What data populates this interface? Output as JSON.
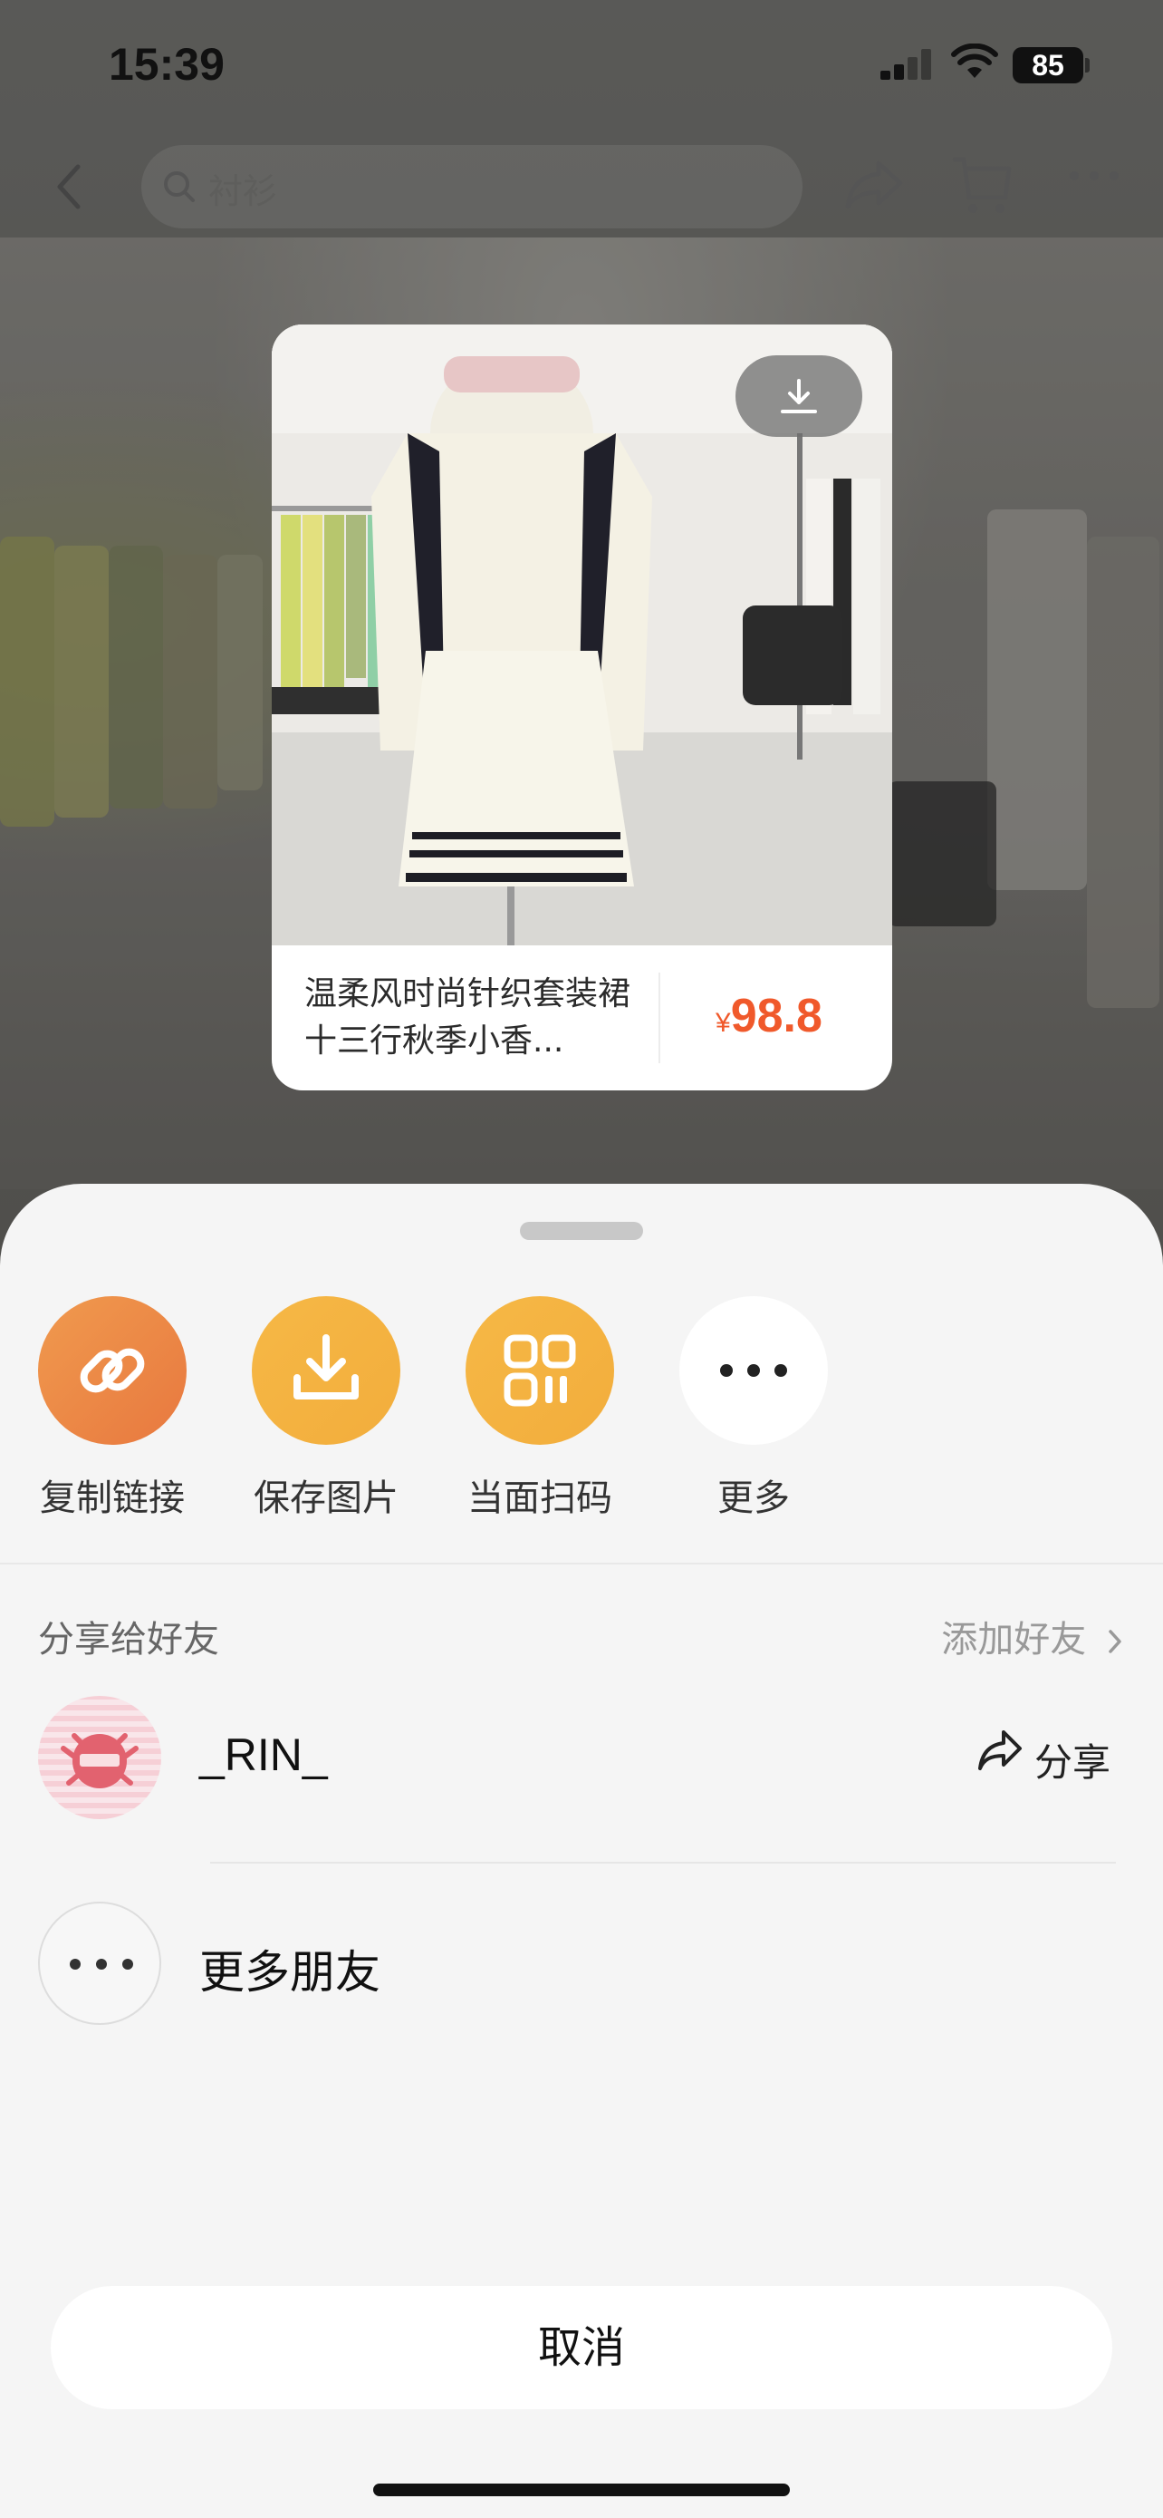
{
  "status_bar": {
    "time": "15:39",
    "battery": "85"
  },
  "nav": {
    "search_placeholder": "衬衫"
  },
  "share_card": {
    "title": "温柔风时尚针织套装裙十三行秋季小香...",
    "currency": "¥",
    "price": "98.8"
  },
  "sheet": {
    "actions": [
      {
        "label": "复制链接",
        "icon": "link-icon",
        "color": "#ec8442"
      },
      {
        "label": "保存图片",
        "icon": "download-icon",
        "color": "#f2ae3d"
      },
      {
        "label": "当面扫码",
        "icon": "qrcode-icon",
        "color": "#f2ae3d"
      },
      {
        "label": "更多",
        "icon": "more-dots-icon",
        "color": "#ffffff"
      }
    ],
    "friends_section_title": "分享给好友",
    "add_friend_label": "添加好友",
    "friends": [
      {
        "name": "_RIN_",
        "share_label": "分享"
      }
    ],
    "more_friends_label": "更多朋友",
    "cancel_label": "取消"
  }
}
